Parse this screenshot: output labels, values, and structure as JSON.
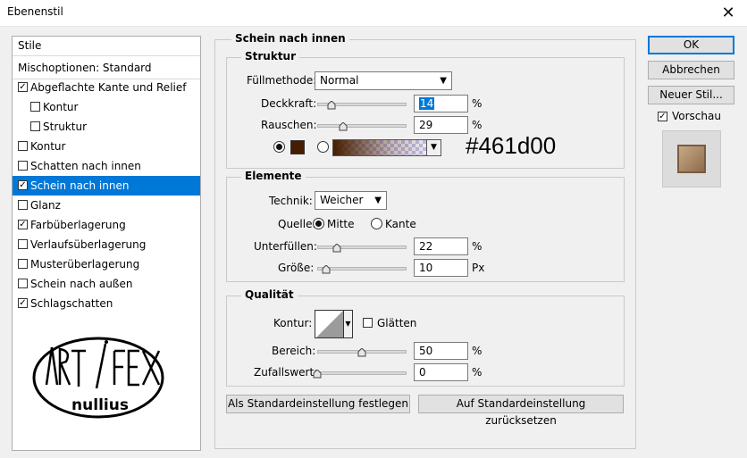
{
  "window": {
    "title": "Ebenenstil",
    "close_glyph": "✕"
  },
  "styles": {
    "header": "Stile",
    "blending_options": "Mischoptionen: Standard",
    "items": [
      {
        "label": "Abgeflachte Kante und Relief",
        "checked": true
      },
      {
        "label": "Kontur",
        "checked": false,
        "indent": true
      },
      {
        "label": "Struktur",
        "checked": false,
        "indent": true
      },
      {
        "label": "Kontur",
        "checked": false
      },
      {
        "label": "Schatten nach innen",
        "checked": false
      },
      {
        "label": "Schein nach innen",
        "checked": true,
        "selected": true
      },
      {
        "label": "Glanz",
        "checked": false
      },
      {
        "label": "Farbüberlagerung",
        "checked": true
      },
      {
        "label": "Verlaufsüberlagerung",
        "checked": false
      },
      {
        "label": "Musterüberlagerung",
        "checked": false
      },
      {
        "label": "Schein nach außen",
        "checked": false
      },
      {
        "label": "Schlagschatten",
        "checked": true
      }
    ]
  },
  "logo": {
    "line1": "ART / FEX",
    "line2": "nullius"
  },
  "panel": {
    "title": "Schein nach innen",
    "structure": {
      "legend": "Struktur",
      "blend_mode_label": "Füllmethode:",
      "blend_mode_value": "Normal",
      "opacity_label": "Deckkraft:",
      "opacity_value": "14",
      "opacity_unit": "%",
      "noise_label": "Rauschen:",
      "noise_value": "29",
      "noise_unit": "%",
      "color_hex": "#461d00",
      "color_label": "#461d00"
    },
    "elements": {
      "legend": "Elemente",
      "technique_label": "Technik:",
      "technique_value": "Weicher",
      "source_label": "Quelle:",
      "source_center": "Mitte",
      "source_edge": "Kante",
      "choke_label": "Unterfüllen:",
      "choke_value": "22",
      "choke_unit": "%",
      "size_label": "Größe:",
      "size_value": "10",
      "size_unit": "Px"
    },
    "quality": {
      "legend": "Qualität",
      "contour_label": "Kontur:",
      "antialias_label": "Glätten",
      "range_label": "Bereich:",
      "range_value": "50",
      "range_unit": "%",
      "jitter_label": "Zufallswert:",
      "jitter_value": "0",
      "jitter_unit": "%"
    },
    "make_default": "Als Standardeinstellung festlegen",
    "reset_default": "Auf Standardeinstellung zurücksetzen"
  },
  "buttons": {
    "ok": "OK",
    "cancel": "Abbrechen",
    "new_style": "Neuer Stil...",
    "preview_label": "Vorschau",
    "preview_checked": true
  },
  "colors": {
    "selection": "#0078d7",
    "glow": "#461d00"
  }
}
